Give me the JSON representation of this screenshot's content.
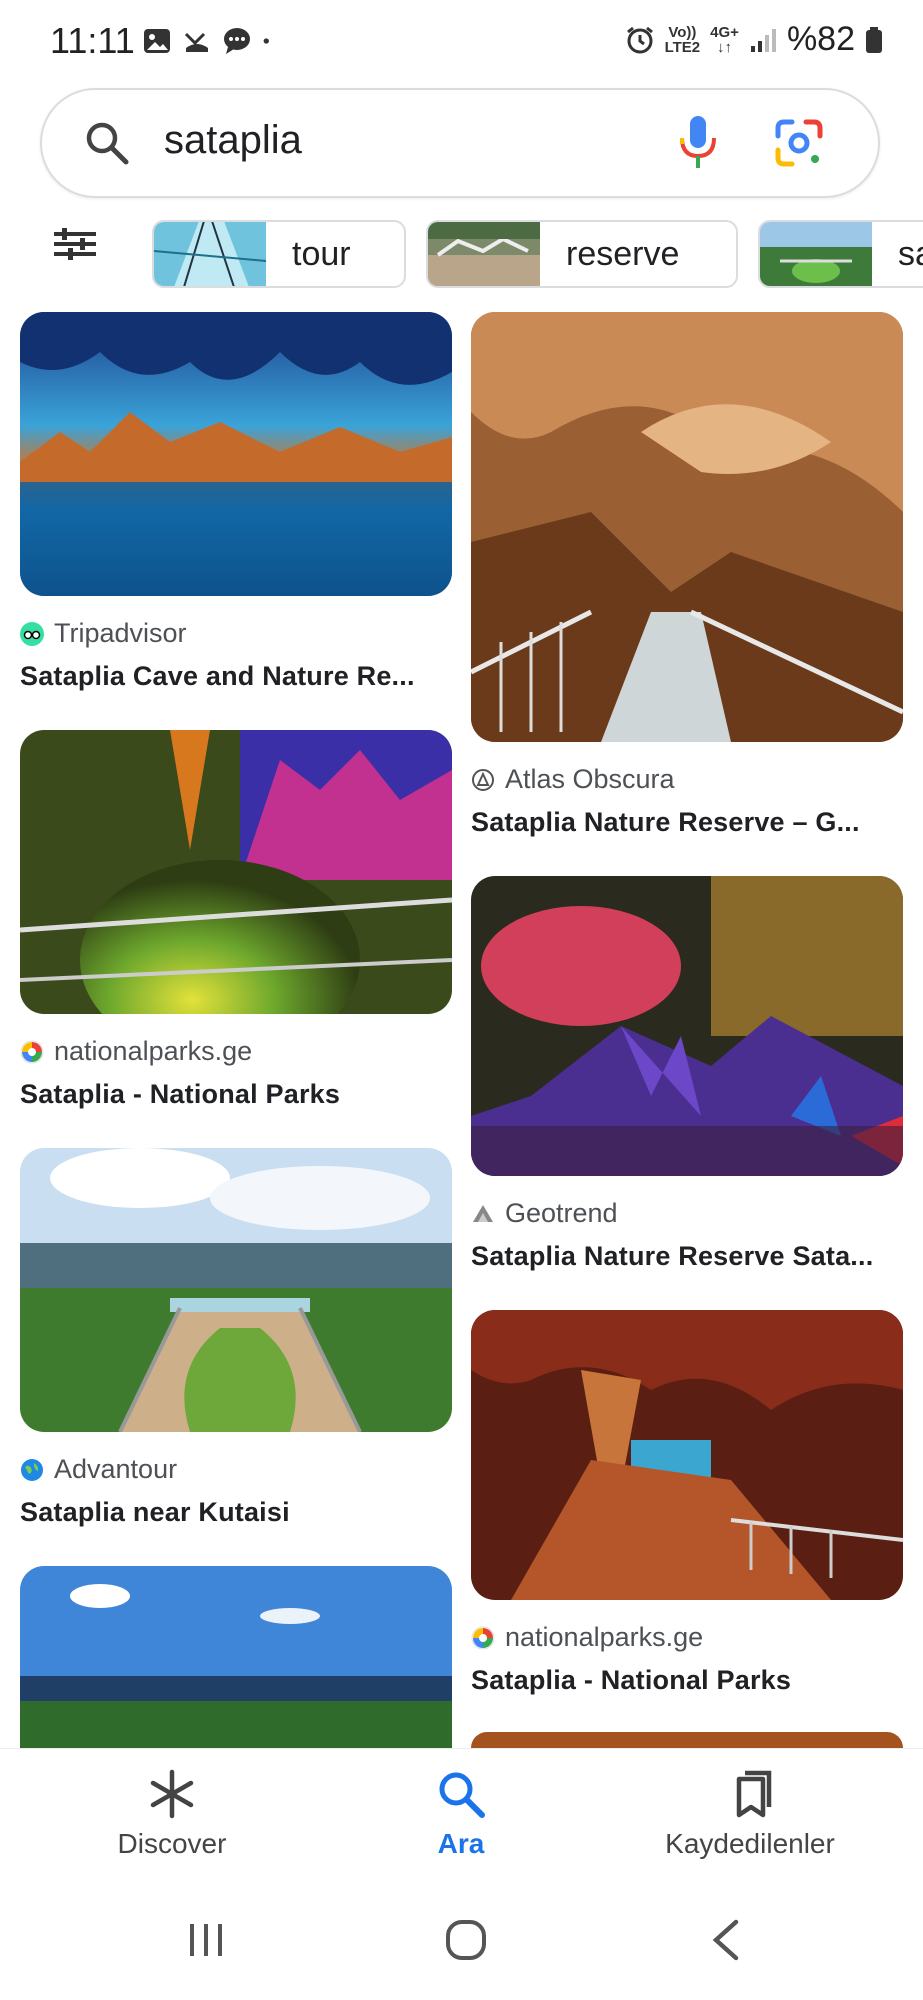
{
  "status_bar": {
    "time": "11:11",
    "network_top": "Vo))",
    "network_bottom": "LTE2",
    "network_type": "4G+",
    "battery": "%82"
  },
  "search": {
    "query": "sataplia"
  },
  "chips": [
    {
      "label": "tour"
    },
    {
      "label": "reserve"
    },
    {
      "label": "sa"
    }
  ],
  "results_left": [
    {
      "source": "Tripadvisor",
      "title": "Sataplia Cave and Nature Re..."
    },
    {
      "source": "nationalparks.ge",
      "title": "Sataplia - National Parks"
    },
    {
      "source": "Advantour",
      "title": "Sataplia near Kutaisi"
    }
  ],
  "results_right": [
    {
      "source": "Atlas Obscura",
      "title": "Sataplia Nature Reserve – G..."
    },
    {
      "source": "Geotrend",
      "title": "Sataplia Nature Reserve Sata..."
    },
    {
      "source": "nationalparks.ge",
      "title": "Sataplia - National Parks"
    }
  ],
  "bottom_nav": {
    "discover": "Discover",
    "search": "Ara",
    "saved": "Kaydedilenler"
  },
  "colors": {
    "accent": "#1a73e8",
    "text": "#202124",
    "secondary_text": "#4d5156"
  }
}
